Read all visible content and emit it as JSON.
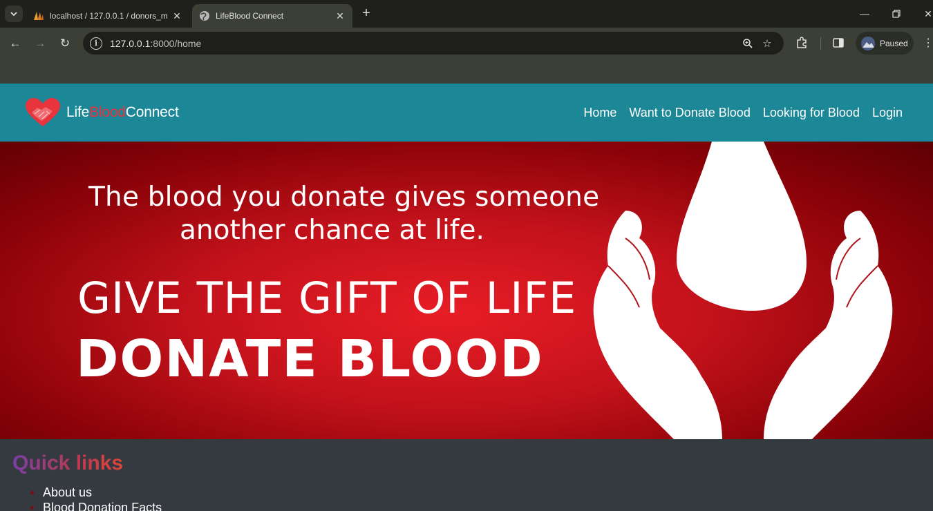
{
  "browser": {
    "tabs": [
      {
        "title": "localhost / 127.0.0.1 / donors_m",
        "favicon": "phpmyadmin-icon",
        "active": false
      },
      {
        "title": "LifeBlood Connect",
        "favicon": "globe-icon",
        "active": true
      }
    ],
    "url": {
      "host": "127.0.0.1",
      "rest": ":8000/home"
    },
    "profile_label": "Paused"
  },
  "site": {
    "brand": {
      "part1": "Life",
      "part2": "Blood",
      "part3": "Connect"
    },
    "nav": [
      "Home",
      "Want to Donate Blood",
      "Looking for Blood",
      "Login"
    ]
  },
  "hero": {
    "line1": "The blood you donate gives someone",
    "line2": "another chance at life.",
    "line3": "GIVE THE GIFT OF LIFE",
    "line4": "DONATE BLOOD"
  },
  "quick_links": {
    "heading": "Quick links",
    "items": [
      "About us",
      "Blood Donation Facts"
    ]
  },
  "colors": {
    "nav_bg": "#1b8797",
    "brand_accent": "#e8343c",
    "hero_red": "#e81d26",
    "footer_bg": "#343a40"
  }
}
